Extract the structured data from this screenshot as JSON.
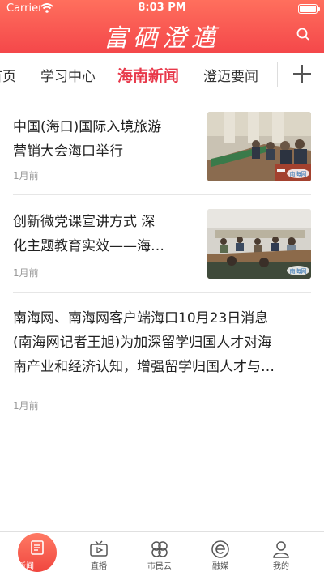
{
  "status": {
    "carrier": "Carrier",
    "time": "8:03 PM"
  },
  "header": {
    "brand": "富硒澄邁"
  },
  "tabs": [
    "首页",
    "学习中心",
    "海南新闻",
    "澄迈要闻"
  ],
  "active_tab_index": 2,
  "articles": [
    {
      "title_line1": "中国(海口)国际入境旅游",
      "title_line2": "营销大会海口举行",
      "time": "1月前",
      "thumb_watermark": "南海网"
    },
    {
      "title_line1": "创新微党课宣讲方式 深",
      "title_line2": "化主题教育实效——海…",
      "time": "1月前",
      "thumb_watermark": "南海网"
    },
    {
      "title_line1": "南海网、南海网客户端海口10月23日消息",
      "title_line2": "(南海网记者王旭)为加深留学归国人才对海",
      "title_line3": "南产业和经济认知，增强留学归国人才与…",
      "time": "1月前"
    }
  ],
  "tabbar": [
    {
      "label": "新闻",
      "icon": "news-icon"
    },
    {
      "label": "直播",
      "icon": "tv-icon"
    },
    {
      "label": "市民云",
      "icon": "clover-icon"
    },
    {
      "label": "融媒",
      "icon": "e-icon"
    },
    {
      "label": "我的",
      "icon": "person-icon"
    }
  ],
  "colors": {
    "accent": "#e8384a",
    "header_top": "#ff6f5d",
    "header_bottom": "#f4474a"
  }
}
